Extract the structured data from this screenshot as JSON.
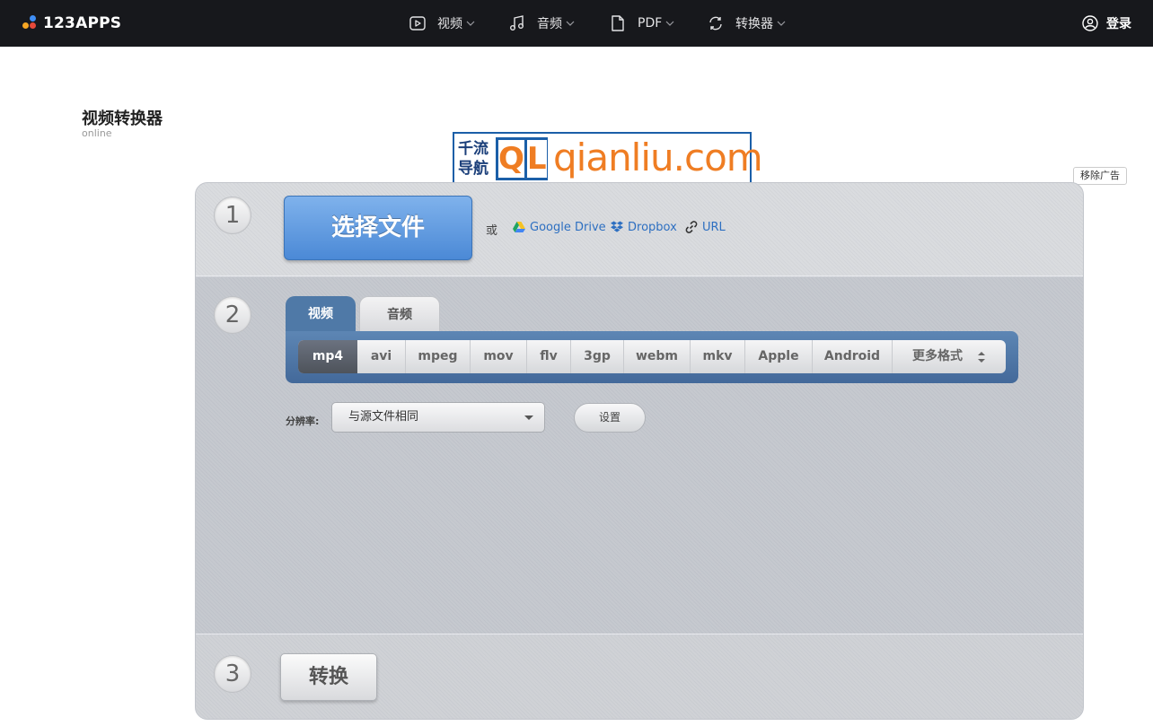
{
  "header": {
    "logo_text": "123APPS",
    "nav": [
      {
        "label": "视频",
        "icon": "play-icon"
      },
      {
        "label": "音频",
        "icon": "music-note-icon"
      },
      {
        "label": "PDF",
        "icon": "document-icon"
      },
      {
        "label": "转换器",
        "icon": "convert-icon"
      }
    ],
    "login_label": "登录"
  },
  "page": {
    "title": "视频转换器",
    "subtitle": "online"
  },
  "ad": {
    "chinese_text": "千流导航",
    "logo_letters": [
      "Q",
      "L"
    ],
    "domain": "qianliu.com",
    "remove_label": "移除广告"
  },
  "step1": {
    "number": "1",
    "choose_label": "选择文件",
    "or_label": "或",
    "sources": [
      {
        "label": "Google Drive",
        "icon": "google-drive-icon"
      },
      {
        "label": "Dropbox",
        "icon": "dropbox-icon"
      },
      {
        "label": "URL",
        "icon": "link-icon"
      }
    ]
  },
  "step2": {
    "number": "2",
    "tabs": [
      {
        "label": "视频",
        "active": true
      },
      {
        "label": "音频",
        "active": false
      }
    ],
    "formats": [
      "mp4",
      "avi",
      "mpeg",
      "mov",
      "flv",
      "3gp",
      "webm",
      "mkv",
      "Apple",
      "Android",
      "更多格式"
    ],
    "selected_format": "mp4",
    "resolution_label": "分辨率:",
    "resolution_value": "与源文件相同",
    "settings_label": "设置"
  },
  "step3": {
    "number": "3",
    "convert_label": "转换"
  },
  "colors": {
    "topbar": "#17181c",
    "primary_blue": "#4b89d6",
    "tab_blue": "#4f79a7",
    "ad_orange": "#ef7d23",
    "ad_blue": "#1b5fa8"
  }
}
